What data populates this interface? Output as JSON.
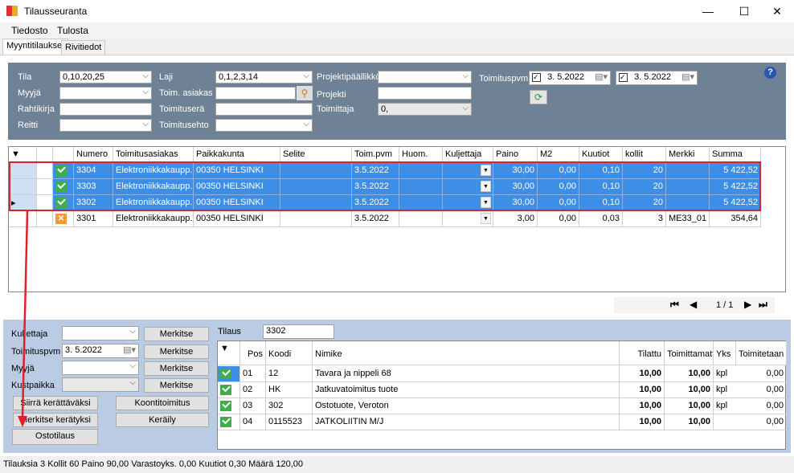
{
  "window": {
    "title": "Tilausseuranta",
    "minimize": "—",
    "maximize": "☐",
    "close": "✕"
  },
  "menu": [
    "Tiedosto",
    "Tulosta"
  ],
  "tabs": [
    "Myyntitilaukset",
    "Rivitiedot"
  ],
  "filters": {
    "tila": {
      "label": "Tila",
      "value": "0,10,20,25"
    },
    "myyja": {
      "label": "Myyjä",
      "value": ""
    },
    "rahtikirja": {
      "label": "Rahtikirja",
      "value": ""
    },
    "reitti": {
      "label": "Reitti",
      "value": ""
    },
    "laji": {
      "label": "Laji",
      "value": "0,1,2,3,14"
    },
    "toim_asiakas": {
      "label": "Toim. asiakas",
      "value": ""
    },
    "toimitusera": {
      "label": "Toimituserä",
      "value": ""
    },
    "toimitusehto": {
      "label": "Toimitusehto",
      "value": ""
    },
    "projektipaallikko": {
      "label": "Projektipäällikkö",
      "value": ""
    },
    "projekti": {
      "label": "Projekti",
      "value": ""
    },
    "toimittaja": {
      "label": "Toimittaja",
      "value": "0,"
    },
    "toimituspvm": {
      "label": "Toimituspvm",
      "from": "3. 5.2022",
      "to": "3. 5.2022",
      "from_checked": true,
      "to_checked": true
    }
  },
  "orders": {
    "columns": [
      "Numero",
      "Toimitusasiakas",
      "Paikkakunta",
      "Selite",
      "Toim.pvm",
      "Huom.",
      "Kuljettaja",
      "Paino",
      "M2",
      "Kuutiot",
      "kollit",
      "Merkki",
      "Summa"
    ],
    "rows": [
      {
        "status": "ok",
        "selected": true,
        "current": false,
        "cells": [
          "3304",
          "Elektroniikkakaupp...",
          "00350  HELSINKI",
          "",
          "3.5.2022",
          "",
          "",
          "30,00",
          "0,00",
          "0,10",
          "20",
          "",
          "5 422,52"
        ]
      },
      {
        "status": "ok",
        "selected": true,
        "current": false,
        "cells": [
          "3303",
          "Elektroniikkakaupp...",
          "00350  HELSINKI",
          "",
          "3.5.2022",
          "",
          "",
          "30,00",
          "0,00",
          "0,10",
          "20",
          "",
          "5 422,52"
        ]
      },
      {
        "status": "ok",
        "selected": true,
        "current": true,
        "cells": [
          "3302",
          "Elektroniikkakaupp...",
          "00350  HELSINKI",
          "",
          "3.5.2022",
          "",
          "",
          "30,00",
          "0,00",
          "0,10",
          "20",
          "",
          "5 422,52"
        ]
      },
      {
        "status": "pending",
        "selected": false,
        "current": false,
        "cells": [
          "3301",
          "Elektroniikkakaupp...",
          "00350  HELSINKI",
          "",
          "3.5.2022",
          "",
          "",
          "3,00",
          "0,00",
          "0,03",
          "3",
          "ME33_01",
          "354,64"
        ]
      }
    ]
  },
  "pager": {
    "text": "1 / 1"
  },
  "actions": {
    "kuljettaja": {
      "label": "Kuljettaja",
      "value": ""
    },
    "toimituspvm": {
      "label": "Toimituspvm",
      "value": "3. 5.2022"
    },
    "myyja": {
      "label": "Myyjä",
      "value": ""
    },
    "kustpaikka": {
      "label": "Kustpaikka",
      "value": ""
    },
    "merkitse": "Merkitse",
    "siirra": "Siirrä kerättäväksi",
    "merkitse_keratyksi": "Merkitse kerätyksi",
    "ostotilaus": "Ostotilaus",
    "koontitoimitus": "Koontitoimitus",
    "keraily": "Keräily"
  },
  "order_detail": {
    "label": "Tilaus",
    "value": "3302",
    "columns": [
      "Pos",
      "Koodi",
      "Nimike",
      "Tilattu",
      "Toimittamatta",
      "Yks",
      "Toimitetaan"
    ],
    "rows": [
      [
        "01",
        "12",
        "Tavara ja nippeli 68",
        "10,00",
        "10,00",
        "kpl",
        "0,00"
      ],
      [
        "02",
        "HK",
        "Jatkuvatoimitus tuote",
        "10,00",
        "10,00",
        "kpl",
        "0,00"
      ],
      [
        "03",
        "302",
        "Ostotuote, Veroton",
        "10,00",
        "10,00",
        "kpl",
        "0,00"
      ],
      [
        "04",
        "0115523",
        "JATKOLIITIN M/J",
        "10,00",
        "10,00",
        "",
        "0,00"
      ]
    ]
  },
  "status_bar": "Tilauksia  3  Kollit  60  Paino  90,00  Varastoyks.  0,00  Kuutiot  0,30  Määrä  120,00",
  "colors": {
    "filter_panel": "#6f8194",
    "selection": "#3d8ee6",
    "highlight": "#e0202a",
    "bottom_panel": "#b9cce4"
  }
}
